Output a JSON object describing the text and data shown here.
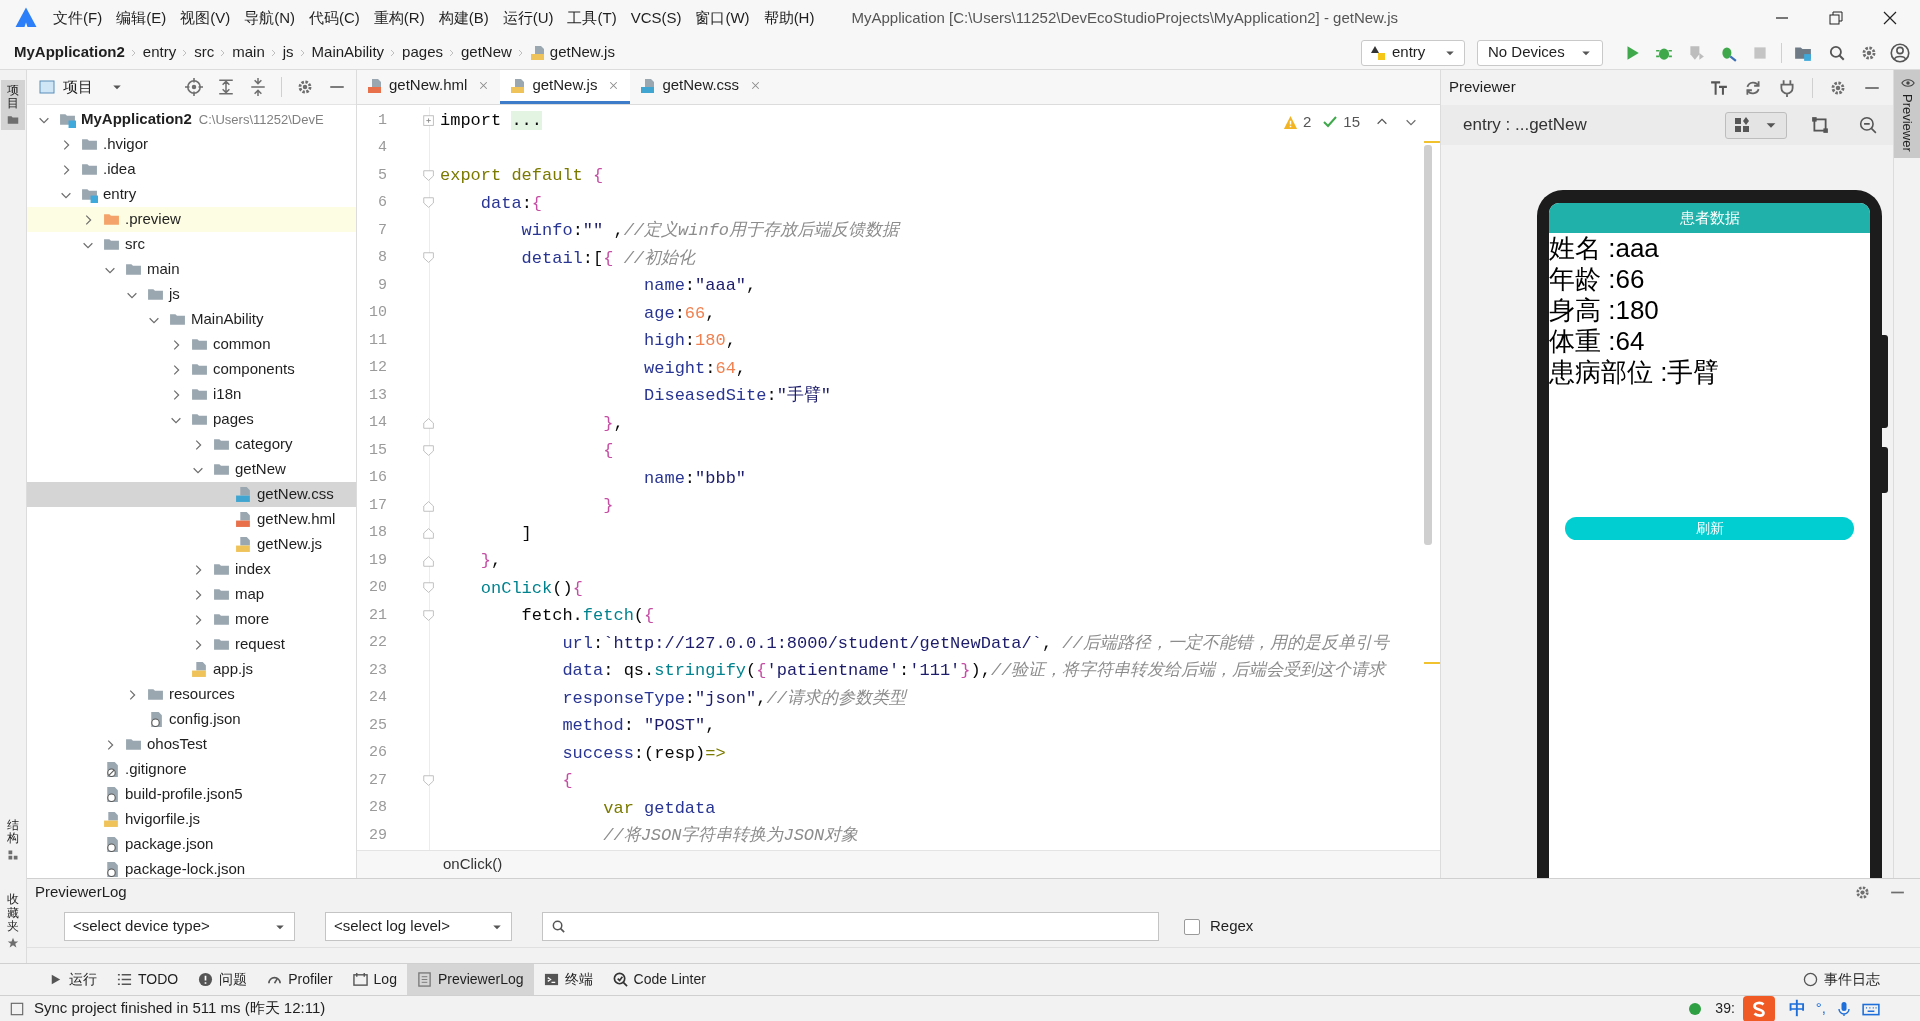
{
  "title_bar": {
    "menus": [
      "文件(F)",
      "编辑(E)",
      "视图(V)",
      "导航(N)",
      "代码(C)",
      "重构(R)",
      "构建(B)",
      "运行(U)",
      "工具(T)",
      "VCS(S)",
      "窗口(W)",
      "帮助(H)"
    ],
    "title": "MyApplication [C:\\Users\\11252\\DevEcoStudioProjects\\MyApplication2] - getNew.js"
  },
  "breadcrumb": [
    {
      "label": "MyApplication2",
      "kind": "project"
    },
    {
      "label": "entry",
      "kind": "folder"
    },
    {
      "label": "src",
      "kind": "folder"
    },
    {
      "label": "main",
      "kind": "folder"
    },
    {
      "label": "js",
      "kind": "folder"
    },
    {
      "label": "MainAbility",
      "kind": "folder"
    },
    {
      "label": "pages",
      "kind": "folder"
    },
    {
      "label": "getNew",
      "kind": "folder"
    },
    {
      "label": "getNew.js",
      "kind": "js"
    }
  ],
  "toolbar": {
    "module": "entry",
    "device": "No Devices"
  },
  "side_tabs": [
    {
      "label": "项目",
      "selected": true
    },
    {
      "label": "结构",
      "selected": false
    },
    {
      "label": "收藏夹",
      "selected": false
    }
  ],
  "project_panel": {
    "title": "项目",
    "tree": [
      {
        "label": "MyApplication2",
        "hint": "C:\\Users\\11252\\DevE",
        "kind": "module",
        "expanded": true,
        "selected": false,
        "children": [
          {
            "label": ".hvigor",
            "kind": "folder",
            "expanded": false,
            "selected": false
          },
          {
            "label": ".idea",
            "kind": "folder",
            "expanded": false,
            "selected": false
          },
          {
            "label": "entry",
            "kind": "module",
            "expanded": true,
            "selected": false,
            "children": [
              {
                "label": ".preview",
                "kind": "excluded",
                "expanded": false,
                "selected": false
              },
              {
                "label": "src",
                "kind": "folder",
                "expanded": true,
                "selected": false,
                "children": [
                  {
                    "label": "main",
                    "kind": "folder",
                    "expanded": true,
                    "selected": false,
                    "children": [
                      {
                        "label": "js",
                        "kind": "folder",
                        "expanded": true,
                        "selected": false,
                        "children": [
                          {
                            "label": "MainAbility",
                            "kind": "folder",
                            "expanded": true,
                            "selected": false,
                            "children": [
                              {
                                "label": "common",
                                "kind": "folder",
                                "expanded": false,
                                "selected": false
                              },
                              {
                                "label": "components",
                                "kind": "folder",
                                "expanded": false,
                                "selected": false
                              },
                              {
                                "label": "i18n",
                                "kind": "folder",
                                "expanded": false,
                                "selected": false
                              },
                              {
                                "label": "pages",
                                "kind": "folder",
                                "expanded": true,
                                "selected": false,
                                "children": [
                                  {
                                    "label": "category",
                                    "kind": "folder",
                                    "expanded": false,
                                    "selected": false
                                  },
                                  {
                                    "label": "getNew",
                                    "kind": "folder",
                                    "expanded": true,
                                    "selected": false,
                                    "children": [
                                      {
                                        "label": "getNew.css",
                                        "kind": "css",
                                        "selected": true
                                      },
                                      {
                                        "label": "getNew.hml",
                                        "kind": "hml",
                                        "selected": false
                                      },
                                      {
                                        "label": "getNew.js",
                                        "kind": "js",
                                        "selected": false
                                      }
                                    ]
                                  },
                                  {
                                    "label": "index",
                                    "kind": "folder",
                                    "expanded": false,
                                    "selected": false
                                  },
                                  {
                                    "label": "map",
                                    "kind": "folder",
                                    "expanded": false,
                                    "selected": false
                                  },
                                  {
                                    "label": "more",
                                    "kind": "folder",
                                    "expanded": false,
                                    "selected": false
                                  },
                                  {
                                    "label": "request",
                                    "kind": "folder",
                                    "expanded": false,
                                    "selected": false
                                  }
                                ]
                              },
                              {
                                "label": "app.js",
                                "kind": "js",
                                "selected": false
                              }
                            ]
                          }
                        ]
                      },
                      {
                        "label": "resources",
                        "kind": "folder",
                        "expanded": false,
                        "selected": false
                      },
                      {
                        "label": "config.json",
                        "kind": "json",
                        "selected": false
                      }
                    ]
                  },
                  {
                    "label": "ohosTest",
                    "kind": "folder",
                    "expanded": false,
                    "selected": false
                  }
                ]
              },
              {
                "label": ".gitignore",
                "kind": "ignore",
                "selected": false
              },
              {
                "label": "build-profile.json5",
                "kind": "json",
                "selected": false
              },
              {
                "label": "hvigorfile.js",
                "kind": "js",
                "selected": false
              },
              {
                "label": "package.json",
                "kind": "json",
                "selected": false
              },
              {
                "label": "package-lock.json",
                "kind": "json",
                "selected": false
              }
            ]
          }
        ]
      }
    ]
  },
  "editor": {
    "tabs": [
      {
        "label": "getNew.hml",
        "kind": "hml",
        "selected": false
      },
      {
        "label": "getNew.js",
        "kind": "js",
        "selected": true
      },
      {
        "label": "getNew.css",
        "kind": "css",
        "selected": false
      }
    ],
    "inspections": {
      "warnings": "2",
      "passed": "15"
    },
    "lines": [
      {
        "number": "1",
        "kind": "folded",
        "tokens": [
          {
            "text": "import ",
            "kind": "plain"
          },
          {
            "text": "...",
            "kind": "folded"
          }
        ]
      },
      {
        "number": "4",
        "kind": "code"
      },
      {
        "number": "5",
        "kind": "fold-start",
        "tokens": [
          {
            "text": "export default ",
            "kind": "keyword"
          },
          {
            "text": "{",
            "kind": "brace"
          }
        ]
      },
      {
        "number": "6",
        "kind": "fold-start",
        "tokens": [
          {
            "text": "    data",
            "kind": "property"
          },
          {
            "text": ":",
            "kind": "plain"
          },
          {
            "text": "{",
            "kind": "brace"
          }
        ]
      },
      {
        "number": "7",
        "kind": "code",
        "tokens": [
          {
            "text": "        winfo",
            "kind": "property"
          },
          {
            "text": ":",
            "kind": "plain"
          },
          {
            "text": "\"\"",
            "kind": "string"
          },
          {
            "text": " ,",
            "kind": "plain"
          },
          {
            "text": "//定义winfo用于存放后端反馈数据",
            "kind": "comment"
          }
        ]
      },
      {
        "number": "8",
        "kind": "fold-start",
        "tokens": [
          {
            "text": "        detail",
            "kind": "property"
          },
          {
            "text": ":[",
            "kind": "plain"
          },
          {
            "text": "{",
            "kind": "brace"
          },
          {
            "text": " //初始化",
            "kind": "comment"
          }
        ]
      },
      {
        "number": "9",
        "kind": "code",
        "tokens": [
          {
            "text": "                    name",
            "kind": "property"
          },
          {
            "text": ":",
            "kind": "plain"
          },
          {
            "text": "\"aaa\"",
            "kind": "string"
          },
          {
            "text": ",",
            "kind": "plain"
          }
        ]
      },
      {
        "number": "10",
        "kind": "code",
        "tokens": [
          {
            "text": "                    age",
            "kind": "property"
          },
          {
            "text": ":",
            "kind": "plain"
          },
          {
            "text": "66",
            "kind": "number"
          },
          {
            "text": ",",
            "kind": "plain"
          }
        ]
      },
      {
        "number": "11",
        "kind": "code",
        "tokens": [
          {
            "text": "                    high",
            "kind": "property"
          },
          {
            "text": ":",
            "kind": "plain"
          },
          {
            "text": "180",
            "kind": "number"
          },
          {
            "text": ",",
            "kind": "plain"
          }
        ]
      },
      {
        "number": "12",
        "kind": "code",
        "tokens": [
          {
            "text": "                    weight",
            "kind": "property"
          },
          {
            "text": ":",
            "kind": "plain"
          },
          {
            "text": "64",
            "kind": "number"
          },
          {
            "text": ",",
            "kind": "plain"
          }
        ]
      },
      {
        "number": "13",
        "kind": "code",
        "tokens": [
          {
            "text": "                    DiseasedSite",
            "kind": "property"
          },
          {
            "text": ":",
            "kind": "plain"
          },
          {
            "text": "\"手臂\"",
            "kind": "string"
          }
        ]
      },
      {
        "number": "14",
        "kind": "fold-end",
        "tokens": [
          {
            "text": "                }",
            "kind": "brace"
          },
          {
            "text": ",",
            "kind": "plain"
          }
        ]
      },
      {
        "number": "15",
        "kind": "fold-start",
        "tokens": [
          {
            "text": "                {",
            "kind": "brace"
          }
        ]
      },
      {
        "number": "16",
        "kind": "code",
        "tokens": [
          {
            "text": "                    name",
            "kind": "property"
          },
          {
            "text": ":",
            "kind": "plain"
          },
          {
            "text": "\"bbb\"",
            "kind": "string"
          }
        ]
      },
      {
        "number": "17",
        "kind": "fold-end",
        "tokens": [
          {
            "text": "                }",
            "kind": "brace"
          }
        ]
      },
      {
        "number": "18",
        "kind": "fold-end",
        "tokens": [
          {
            "text": "        ]",
            "kind": "plain"
          }
        ]
      },
      {
        "number": "19",
        "kind": "fold-end",
        "tokens": [
          {
            "text": "    }",
            "kind": "brace"
          },
          {
            "text": ",",
            "kind": "plain"
          }
        ]
      },
      {
        "number": "20",
        "kind": "fold-start",
        "tokens": [
          {
            "text": "    onClick",
            "kind": "function"
          },
          {
            "text": "()",
            "kind": "plain"
          },
          {
            "text": "{",
            "kind": "brace"
          }
        ]
      },
      {
        "number": "21",
        "kind": "fold-start",
        "tokens": [
          {
            "text": "        fetch.",
            "kind": "plain"
          },
          {
            "text": "fetch",
            "kind": "function"
          },
          {
            "text": "(",
            "kind": "plain"
          },
          {
            "text": "{",
            "kind": "brace"
          }
        ]
      },
      {
        "number": "22",
        "kind": "code",
        "tokens": [
          {
            "text": "            url",
            "kind": "property"
          },
          {
            "text": ":",
            "kind": "plain"
          },
          {
            "text": "`http://127.0.0.1:8000/student/getNewData/`",
            "kind": "string"
          },
          {
            "text": ", ",
            "kind": "plain"
          },
          {
            "text": "//后端路径，一定不能错，用的是反单引号",
            "kind": "comment"
          }
        ]
      },
      {
        "number": "23",
        "kind": "code",
        "tokens": [
          {
            "text": "            data",
            "kind": "property"
          },
          {
            "text": ": qs.",
            "kind": "plain"
          },
          {
            "text": "stringify",
            "kind": "function"
          },
          {
            "text": "(",
            "kind": "plain"
          },
          {
            "text": "{",
            "kind": "brace"
          },
          {
            "text": "'patientname'",
            "kind": "string"
          },
          {
            "text": ":",
            "kind": "plain"
          },
          {
            "text": "'111'",
            "kind": "string"
          },
          {
            "text": "}",
            "kind": "brace"
          },
          {
            "text": "),",
            "kind": "plain"
          },
          {
            "text": "//验证，将字符串转发给后端，后端会受到这个请求",
            "kind": "comment"
          }
        ]
      },
      {
        "number": "24",
        "kind": "code",
        "tokens": [
          {
            "text": "            responseType",
            "kind": "property"
          },
          {
            "text": ":",
            "kind": "plain"
          },
          {
            "text": "\"json\"",
            "kind": "string"
          },
          {
            "text": ",",
            "kind": "plain"
          },
          {
            "text": "//请求的参数类型",
            "kind": "comment"
          }
        ]
      },
      {
        "number": "25",
        "kind": "code",
        "tokens": [
          {
            "text": "            method",
            "kind": "property"
          },
          {
            "text": ": ",
            "kind": "plain"
          },
          {
            "text": "\"POST\"",
            "kind": "string"
          },
          {
            "text": ",",
            "kind": "plain"
          }
        ]
      },
      {
        "number": "26",
        "kind": "code",
        "tokens": [
          {
            "text": "            success",
            "kind": "property"
          },
          {
            "text": ":(resp)",
            "kind": "plain"
          },
          {
            "text": "=>",
            "kind": "keyword"
          }
        ]
      },
      {
        "number": "27",
        "kind": "fold-start",
        "tokens": [
          {
            "text": "            {",
            "kind": "brace"
          }
        ]
      },
      {
        "number": "28",
        "kind": "code",
        "tokens": [
          {
            "text": "                var",
            "kind": "keyword"
          },
          {
            "text": " getdata",
            "kind": "property"
          }
        ]
      },
      {
        "number": "29",
        "kind": "code",
        "tokens": [
          {
            "text": "                //将JSON字符串转换为JSON对象",
            "kind": "comment"
          }
        ]
      }
    ],
    "breadcrumb": "onClick()"
  },
  "previewer": {
    "title": "Previewer",
    "page": "entry : ...getNew",
    "side_tab": "Previewer",
    "device": {
      "title": "患者数据",
      "fields": [
        "姓名 :aaa",
        "年龄 :66",
        "身高 :180",
        "体重 :64",
        "患病部位 :手臂"
      ],
      "button": "刷新"
    }
  },
  "previewer_log": {
    "title": "PreviewerLog",
    "device_type": "<select device type>",
    "log_level": "<select log level>",
    "regex": {
      "label": "Regex",
      "checked": false
    }
  },
  "tool_windows": [
    {
      "label": "运行",
      "kind": "run",
      "selected": false
    },
    {
      "label": "TODO",
      "kind": "todo",
      "selected": false
    },
    {
      "label": "问题",
      "kind": "problems",
      "selected": false
    },
    {
      "label": "Profiler",
      "kind": "profiler",
      "selected": false
    },
    {
      "label": "Log",
      "kind": "log",
      "selected": false
    },
    {
      "label": "PreviewerLog",
      "kind": "previewer",
      "selected": true
    },
    {
      "label": "终端",
      "kind": "terminal",
      "selected": false
    },
    {
      "label": "Code Linter",
      "kind": "linter",
      "selected": false
    }
  ],
  "event_log": "事件日志",
  "status_bar": {
    "message": "Sync project finished in 511 ms (昨天 12:11)",
    "position": "39:",
    "ime": {
      "mode": "中",
      "punctuation": "°,"
    }
  }
}
